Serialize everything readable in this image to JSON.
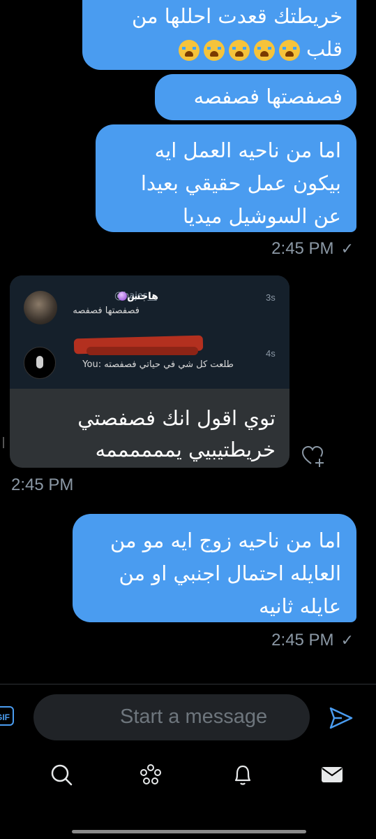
{
  "messages": {
    "out1": {
      "line1": "خريطتك قعدت احللها من",
      "line2": "قلب"
    },
    "out2": {
      "text": "فصفصتها فصفصه"
    },
    "out3": {
      "line1": "اما من ناحيه العمل ايه",
      "line2": "بيكون عمل حقيقي بعيدا",
      "line3": "عن السوشيل ميديا",
      "time": "2:45 PM",
      "status_icon": "check-icon"
    },
    "incoming": {
      "screenshot": {
        "row1": {
          "name": "هاجس",
          "handle": "@hajes__",
          "time": "3s",
          "message": "فصفصتها فصفصه"
        },
        "row2": {
          "time": "4s",
          "message": "طلعت كل شي في حياتي فصفصته :You"
        }
      },
      "line1": "توي اقول انك فصفصتي",
      "line2": "خريطتيبيي يممممممه",
      "time": "2:45 PM"
    },
    "out4": {
      "line1": "اما من ناحيه زوج ايه مو من",
      "line2": "العايله احتمال اجنبي او من",
      "line3": "عايله ثانيه",
      "time": "2:45 PM",
      "status_icon": "check-icon"
    }
  },
  "composer": {
    "placeholder": "Start a message",
    "gif_label": "GIF"
  },
  "nav": [
    "search-icon",
    "spaces-icon",
    "bell-icon",
    "mail-icon"
  ],
  "colors": {
    "accent": "#4a9cf0",
    "background": "#000000",
    "incoming_bubble": "#2f3336",
    "muted": "#8b98a5"
  }
}
